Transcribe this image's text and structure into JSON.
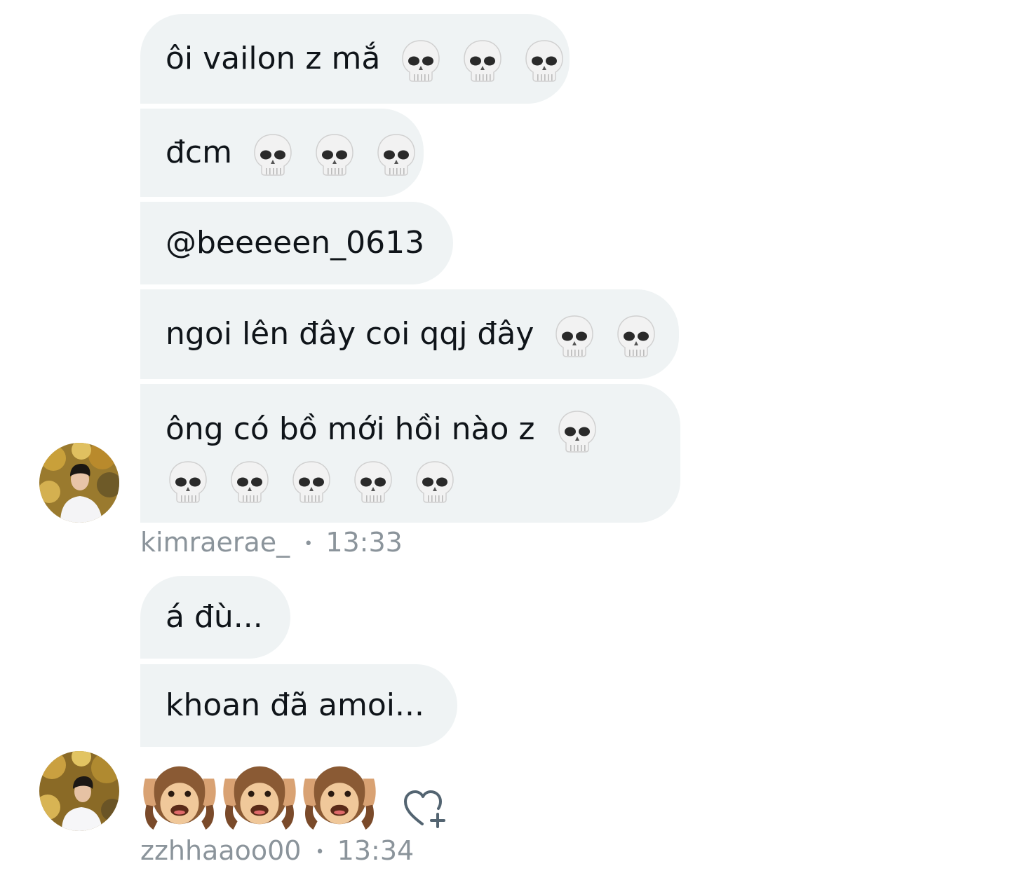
{
  "conversation": {
    "group1": {
      "messages": [
        {
          "text": "ôi vailon z mắ",
          "emoji": "skull",
          "emoji_count": 3
        },
        {
          "text": "đcm",
          "emoji": "skull",
          "emoji_count": 3
        },
        {
          "text": "@beeeeen_0613"
        },
        {
          "text": "ngoi lên đây coi qqj đây",
          "emoji": "skull",
          "emoji_count": 2
        },
        {
          "text": "ông có bồ mới hồi nào z",
          "emoji": "skull",
          "emoji_count": 6
        }
      ],
      "meta": {
        "username": "kimraerae_",
        "separator": "•",
        "time": "13:33"
      }
    },
    "group2": {
      "messages": [
        {
          "text": "á đù..."
        },
        {
          "text": "khoan đã amoi..."
        },
        {
          "text": "",
          "emoji": "hear-no-evil-monkey",
          "emoji_count": 3
        }
      ],
      "meta": {
        "username": "zzhhaaoo00",
        "separator": "•",
        "time": "13:34"
      }
    }
  },
  "colors": {
    "bubble_bg": "#eff3f4",
    "text": "#0f1419",
    "meta_text": "#8b949b",
    "icon": "#536471"
  },
  "icons": {
    "reaction": "heart-plus-icon"
  }
}
